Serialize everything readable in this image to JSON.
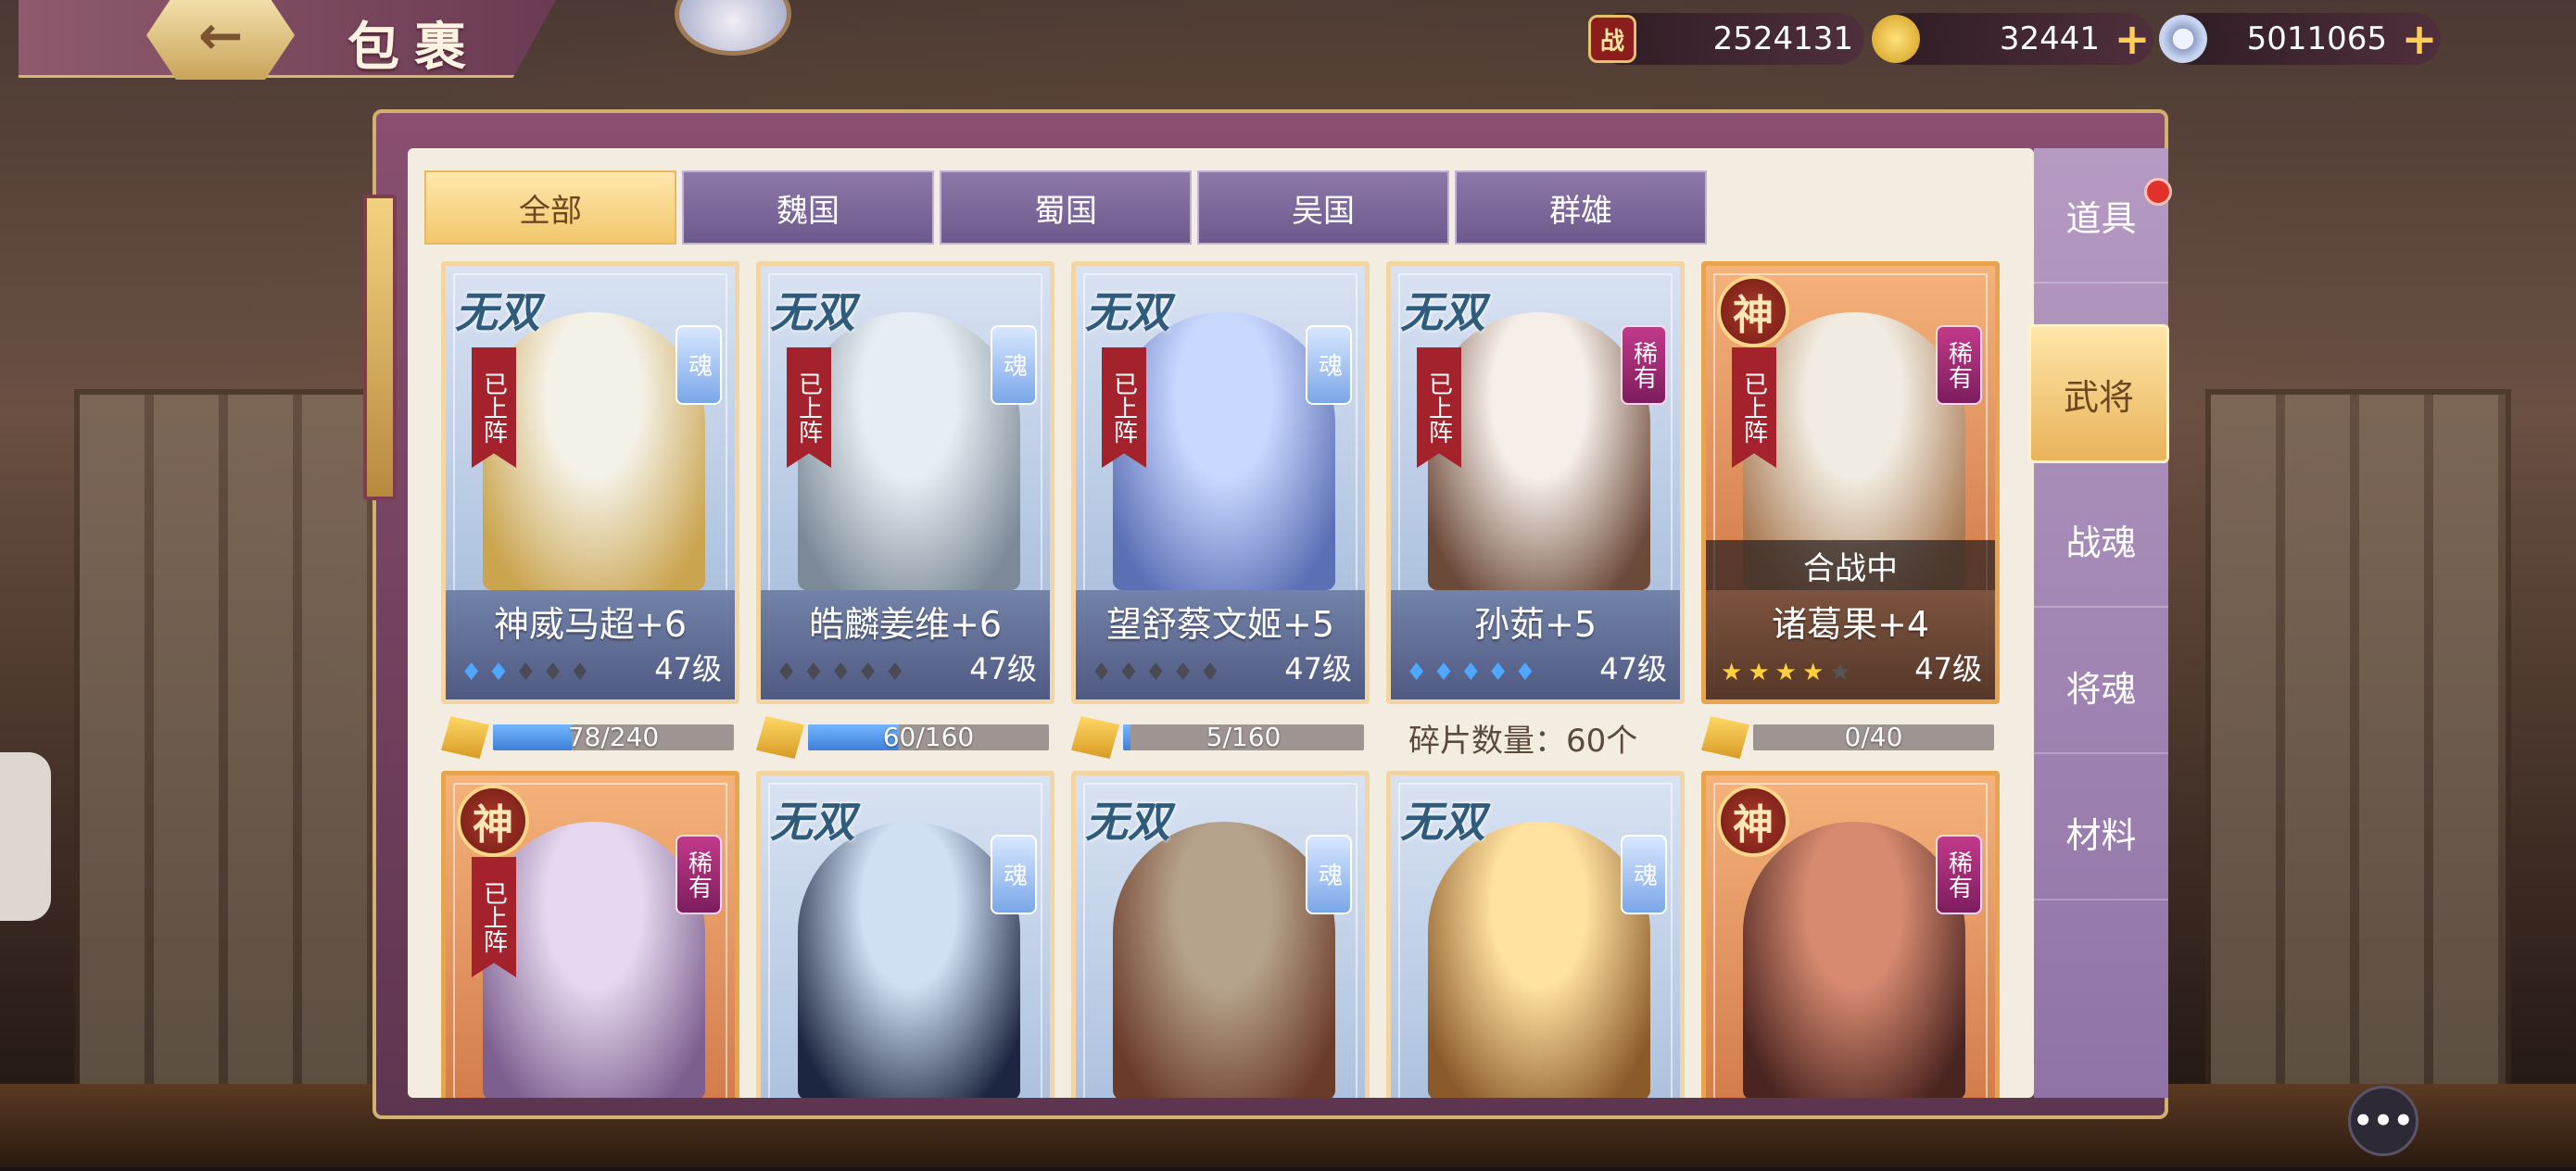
{
  "header": {
    "title": "包裹",
    "back_icon": "←"
  },
  "resources": [
    {
      "icon_text": "战",
      "value": "2524131",
      "has_plus": false
    },
    {
      "icon_text": "",
      "value": "32441",
      "has_plus": true
    },
    {
      "icon_text": "",
      "value": "5011065",
      "has_plus": true
    }
  ],
  "tabs": [
    {
      "label": "全部",
      "active": true
    },
    {
      "label": "魏国",
      "active": false
    },
    {
      "label": "蜀国",
      "active": false
    },
    {
      "label": "吴国",
      "active": false
    },
    {
      "label": "群雄",
      "active": false
    }
  ],
  "side_menu": [
    {
      "label": "道具",
      "active": false
    },
    {
      "label": "武将",
      "active": true
    },
    {
      "label": "战魂",
      "active": false
    },
    {
      "label": "将魂",
      "active": false
    },
    {
      "label": "材料",
      "active": false
    }
  ],
  "badges": {
    "wushuang": "无双",
    "shen": "神",
    "deployed": "已上阵",
    "soul": "魂",
    "rare": "稀有"
  },
  "cards_row1": [
    {
      "name": "神威马超+6",
      "level": "47级",
      "kind": "wushuang",
      "badge": "soul",
      "deployed": true,
      "status": "",
      "marks": "drops",
      "on": 2,
      "portrait_colors": [
        "#f4f1e6",
        "#caa44f"
      ],
      "progress": {
        "text": "78/240",
        "fraction": 0.325
      }
    },
    {
      "name": "皓麟姜维+6",
      "level": "47级",
      "kind": "wushuang",
      "badge": "soul",
      "deployed": true,
      "status": "",
      "marks": "drops",
      "on": 0,
      "portrait_colors": [
        "#e7eef3",
        "#7c8a98"
      ],
      "progress": {
        "text": "60/160",
        "fraction": 0.375
      }
    },
    {
      "name": "望舒蔡文姬+5",
      "level": "47级",
      "kind": "wushuang",
      "badge": "soul",
      "deployed": true,
      "status": "",
      "marks": "drops",
      "on": 0,
      "portrait_colors": [
        "#c9d8ff",
        "#5b6fb5"
      ],
      "progress": {
        "text": "5/160",
        "fraction": 0.03
      }
    },
    {
      "name": "孙茹+5",
      "level": "47级",
      "kind": "wushuang",
      "badge": "rare",
      "deployed": true,
      "status": "",
      "marks": "drops",
      "on": 5,
      "portrait_colors": [
        "#f6efe9",
        "#6c4a3a"
      ],
      "shard_text": "碎片数量：60个"
    },
    {
      "name": "诸葛果+4",
      "level": "47级",
      "kind": "shen",
      "badge": "rare",
      "deployed": true,
      "status": "合战中",
      "marks": "stars",
      "on": 4,
      "portrait_colors": [
        "#f1ece1",
        "#a97a54"
      ],
      "progress": {
        "text": "0/40",
        "fraction": 0
      }
    }
  ],
  "cards_row2": [
    {
      "kind": "shen",
      "badge": "rare",
      "deployed": true,
      "portrait_colors": [
        "#e6d9ef",
        "#7d5f8f"
      ]
    },
    {
      "kind": "wushuang",
      "badge": "soul",
      "deployed": false,
      "portrait_colors": [
        "#cfe0f5",
        "#1d2640"
      ]
    },
    {
      "kind": "wushuang",
      "badge": "soul",
      "deployed": false,
      "portrait_colors": [
        "#b6a38b",
        "#6b3b2a"
      ]
    },
    {
      "kind": "wushuang",
      "badge": "soul",
      "deployed": false,
      "portrait_colors": [
        "#ffe1a0",
        "#8b5a2a"
      ]
    },
    {
      "kind": "shen",
      "badge": "rare",
      "deployed": false,
      "portrait_colors": [
        "#d78a70",
        "#4a2420"
      ]
    }
  ],
  "chat_icon": "•••"
}
